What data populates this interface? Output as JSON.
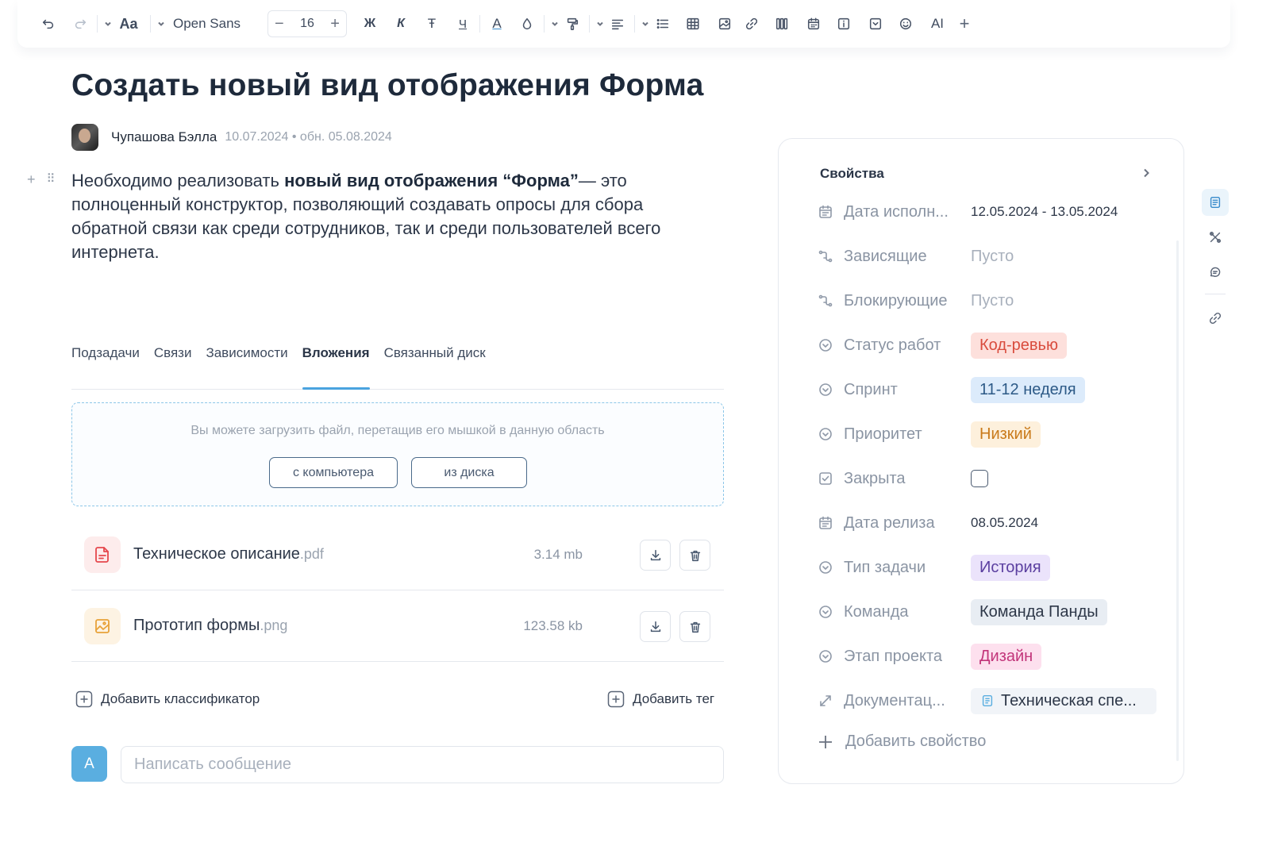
{
  "toolbar": {
    "font_name": "Open Sans",
    "font_size": "16",
    "aa_label": "Aa",
    "bold_label": "Ж",
    "italic_label": "К",
    "strike_label": "Ŧ",
    "underline_label": "Ч",
    "color_label": "A",
    "ai_label": "AI",
    "plus_label": "+"
  },
  "page": {
    "title": "Создать новый вид отображения Форма",
    "author": "Чупашова Бэлла",
    "dates": "10.07.2024 • обн. 05.08.2024",
    "description_pre": "Необходимо реализовать ",
    "description_bold": "новый вид отображения “Форма”",
    "description_post": "— это полноценный конструктор, позволяющий создавать опросы для сбора обратной связи как среди сотрудников, так и среди пользователей всего интернета."
  },
  "tabs": [
    {
      "label": "Подзадачи"
    },
    {
      "label": "Связи"
    },
    {
      "label": "Зависимости"
    },
    {
      "label": "Вложения",
      "active": true
    },
    {
      "label": "Связанный диск"
    }
  ],
  "upload": {
    "hint": "Вы можете загрузить файл, перетащив его мышкой в данную область",
    "from_computer": "с компьютера",
    "from_disk": "из диска"
  },
  "files": [
    {
      "name": "Техническое описание",
      "ext": ".pdf",
      "size": "3.14 mb",
      "icon": "pdf-file-icon",
      "icon_color": "#e5484d",
      "bg": "#fdecec"
    },
    {
      "name": "Прототип формы",
      "ext": ".png",
      "size": "123.58 kb",
      "icon": "image-file-icon",
      "icon_color": "#e8a23a",
      "bg": "#fdf3e3"
    }
  ],
  "actions": {
    "add_classifier": "Добавить классификатор",
    "add_tag": "Добавить тег"
  },
  "message": {
    "avatar_letter": "А",
    "placeholder": "Написать сообщение"
  },
  "properties": {
    "header": "Свойства",
    "rows": [
      {
        "icon": "calendar-icon",
        "label": "Дата исполн...",
        "value": "12.05.2024 - 13.05.2024",
        "kind": "text"
      },
      {
        "icon": "dependency-icon",
        "label": "Зависящие",
        "value": "Пусто",
        "kind": "empty"
      },
      {
        "icon": "dependency-icon",
        "label": "Блокирующие",
        "value": "Пусто",
        "kind": "empty"
      },
      {
        "icon": "select-icon",
        "label": "Статус работ",
        "value": "Код-ревью",
        "kind": "chip",
        "bg": "#fde0dc",
        "fg": "#d94c3d"
      },
      {
        "icon": "select-icon",
        "label": "Спринт",
        "value": "11-12 неделя",
        "kind": "chip",
        "bg": "#dcebfb",
        "fg": "#2d5a87"
      },
      {
        "icon": "select-icon",
        "label": "Приоритет",
        "value": "Низкий",
        "kind": "chip",
        "bg": "#fdf0dc",
        "fg": "#c97a1a"
      },
      {
        "icon": "checkbox-icon",
        "label": "Закрыта",
        "value": "",
        "kind": "checkbox"
      },
      {
        "icon": "calendar-icon",
        "label": "Дата релиза",
        "value": "08.05.2024",
        "kind": "text"
      },
      {
        "icon": "select-icon",
        "label": "Тип задачи",
        "value": "История",
        "kind": "chip",
        "bg": "#ebe3fb",
        "fg": "#5b3fa0"
      },
      {
        "icon": "select-icon",
        "label": "Команда",
        "value": "Команда Панды",
        "kind": "chip",
        "bg": "#e8edf3",
        "fg": "#2d3748"
      },
      {
        "icon": "select-icon",
        "label": "Этап проекта",
        "value": "Дизайн",
        "kind": "chip",
        "bg": "#fde0ee",
        "fg": "#c2357a"
      },
      {
        "icon": "relation-icon",
        "label": "Документац...",
        "value": "Техническая спе...",
        "kind": "doc"
      }
    ],
    "add_property": "Добавить свойство"
  }
}
